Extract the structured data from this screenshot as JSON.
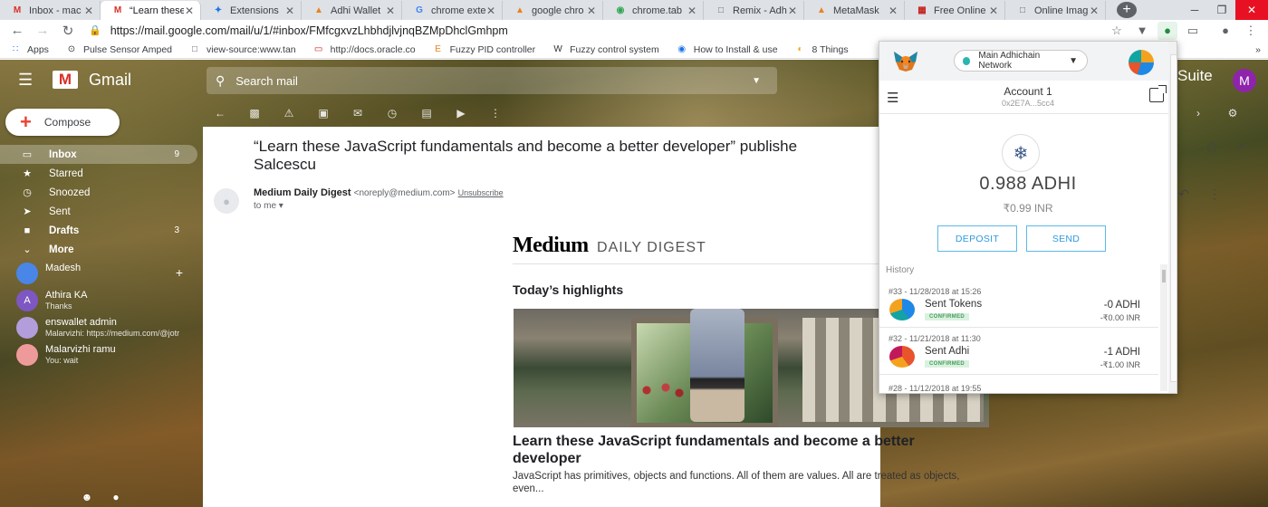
{
  "tabs": [
    {
      "label": "Inbox - mac",
      "icon": "M",
      "color": "#d93025"
    },
    {
      "label": "“Learn these",
      "icon": "M",
      "color": "#d93025"
    },
    {
      "label": "Extensions",
      "icon": "✦",
      "color": "#1a73e8"
    },
    {
      "label": "Adhi Wallet",
      "icon": "▲",
      "color": "#e8821e"
    },
    {
      "label": "chrome exte",
      "icon": "G",
      "color": "#4285f4"
    },
    {
      "label": "google chro",
      "icon": "▲",
      "color": "#e8821e"
    },
    {
      "label": "chrome.tab",
      "icon": "◉",
      "color": "#34a853"
    },
    {
      "label": "Remix - Adh",
      "icon": "□",
      "color": "#5f6368"
    },
    {
      "label": "MetaMask",
      "icon": "▲",
      "color": "#e8821e"
    },
    {
      "label": "Free Online",
      "icon": "▦",
      "color": "#c5221f"
    },
    {
      "label": "Online Imag",
      "icon": "□",
      "color": "#5f6368"
    }
  ],
  "active_tab": 1,
  "window_controls": {
    "minimize": "─",
    "restore": "❐",
    "close": "✕"
  },
  "address_bar": {
    "url": "https://mail.google.com/mail/u/1/#inbox/FMfcgxvzLhbhdjlvjnqBZMpDhclGmhpm"
  },
  "bookmarks": [
    {
      "label": "Apps",
      "icon": "∷",
      "color": "#1a73e8"
    },
    {
      "label": "Pulse Sensor Amped",
      "icon": "⊙",
      "color": "#333"
    },
    {
      "label": "view-source:www.tan",
      "icon": "□",
      "color": "#5f6368"
    },
    {
      "label": "http://docs.oracle.co",
      "icon": "▭",
      "color": "#c5221f"
    },
    {
      "label": "Fuzzy PID controller",
      "icon": "E",
      "color": "#e8821e"
    },
    {
      "label": "Fuzzy control system",
      "icon": "W",
      "color": "#333"
    },
    {
      "label": "How to Install & use",
      "icon": "◉",
      "color": "#1a73e8"
    },
    {
      "label": "8 Things",
      "icon": "◐",
      "color": "#f4a21e"
    }
  ],
  "gmail": {
    "brand": "Gmail",
    "search_placeholder": "Search mail",
    "suite_text": "Suite",
    "account_initial": "M",
    "compose_label": "Compose",
    "nav": [
      {
        "label": "Inbox",
        "icon": "▭",
        "count": "9",
        "bold": true
      },
      {
        "label": "Starred",
        "icon": "★",
        "count": "",
        "bold": false
      },
      {
        "label": "Snoozed",
        "icon": "◷",
        "count": "",
        "bold": false
      },
      {
        "label": "Sent",
        "icon": "➤",
        "count": "",
        "bold": false
      },
      {
        "label": "Drafts",
        "icon": "■",
        "count": "3",
        "bold": true
      },
      {
        "label": "More",
        "icon": "⌄",
        "count": "",
        "bold": true
      }
    ],
    "hangouts": [
      {
        "name": "Madesh",
        "sub": "",
        "initial": "",
        "color": "#4a86e8"
      },
      {
        "name": "Athira KA",
        "sub": "Thanks",
        "initial": "A",
        "color": "#7e57c2"
      },
      {
        "name": "enswallet admin",
        "sub": "Malarvizhi: https://medium.com/@jotr",
        "initial": "",
        "color": "#b39ddb"
      },
      {
        "name": "Malarvizhi ramu",
        "sub": "You: wait",
        "initial": "",
        "color": "#ef9a9a"
      }
    ],
    "email": {
      "subject": "“Learn these JavaScript fundamentals and become a better developer” published by Alexander Salcescu",
      "subject_visible": "“Learn these JavaScript fundamentals and become a better developer” publishe",
      "subject_line2": "Salcescu",
      "sender_name": "Medium Daily Digest",
      "sender_email": "<noreply@medium.com>",
      "unsubscribe": "Unsubscribe",
      "to": "to me",
      "brand_medium": "Medium",
      "brand_digest": "DAILY DIGEST",
      "highlights": "Today’s highlights",
      "article_title": "Learn these JavaScript fundamentals and become a better developer",
      "article_sub": "JavaScript has primitives, objects and functions. All of them are values. All are treated as objects, even..."
    }
  },
  "metamask": {
    "network": "Main Adhichain Network",
    "account_name": "Account 1",
    "account_address": "0x2E7A...5cc4",
    "balance": "0.988 ADHI",
    "fiat": "₹0.99 INR",
    "deposit_label": "DEPOSIT",
    "send_label": "SEND",
    "history_label": "History",
    "history": [
      {
        "date": "#33 - 11/28/2018 at 15:26",
        "title": "Sent Tokens",
        "status": "CONFIRMED",
        "amount": "-0 ADHI",
        "fiat": "-₹0.00 INR",
        "colors": [
          "#1e88e5",
          "#14a3a3",
          "#f4a21e"
        ]
      },
      {
        "date": "#32 - 11/21/2018 at 11:30",
        "title": "Sent Adhi",
        "status": "CONFIRMED",
        "amount": "-1 ADHI",
        "fiat": "-₹1.00 INR",
        "colors": [
          "#e8542b",
          "#f4a21e",
          "#c2185b"
        ]
      }
    ],
    "partial_history": "#28 - 11/12/2018 at 19:55"
  }
}
